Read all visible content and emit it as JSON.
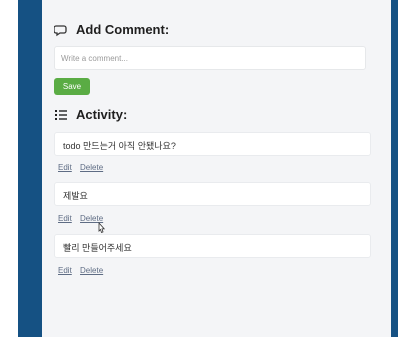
{
  "add_comment": {
    "title": "Add Comment:",
    "icon": "comment-icon",
    "placeholder": "Write a comment...",
    "save_label": "Save"
  },
  "activity": {
    "title": "Activity:",
    "icon": "list-icon",
    "items": [
      {
        "text": "todo 만드는거 아직 안됐나요?",
        "edit": "Edit",
        "delete": "Delete"
      },
      {
        "text": "제발요",
        "edit": "Edit",
        "delete": "Delete"
      },
      {
        "text": "빨리 만들어주세요",
        "edit": "Edit",
        "delete": "Delete"
      }
    ]
  },
  "colors": {
    "frame": "#155183",
    "panel": "#f4f5f7",
    "save_button": "#5aac44"
  }
}
